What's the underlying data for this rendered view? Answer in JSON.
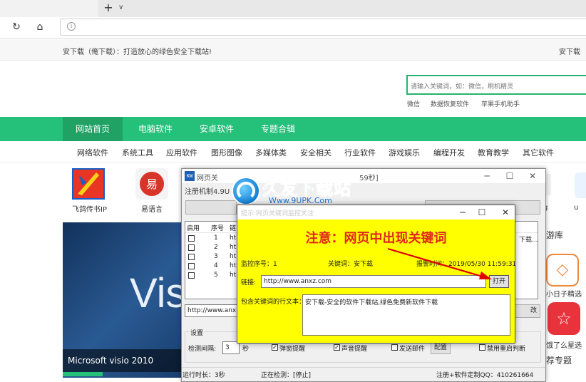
{
  "browser": {
    "new_tab": "+",
    "tab_menu": "∨",
    "reload_icon": "↻",
    "home_icon": "⌂",
    "address_info_icon": "i"
  },
  "site": {
    "slogan": "安下载（俺下载）：打造放心的绿色安全下载站!",
    "top_right_link": "安下载",
    "search_placeholder": "请输入关键词，如：微信，刷机精灵",
    "hot_words": [
      "微信",
      "数据恢复软件",
      "苹果手机助手"
    ],
    "main_nav": [
      "网站首页",
      "电脑软件",
      "安卓软件",
      "专题合辑"
    ],
    "sub_nav": [
      "网络软件",
      "系统工具",
      "应用软件",
      "图形图像",
      "多媒体类",
      "安全相关",
      "行业软件",
      "游戏娱乐",
      "编程开发",
      "教育教学",
      "其它软件"
    ],
    "apps": [
      {
        "label": "飞鸽传书IP"
      },
      {
        "label": "易语言"
      }
    ],
    "banner_word": "Visio",
    "banner_caption": "Microsoft visio 2010",
    "side_label_1": "游库",
    "side_label_2": "荐专题",
    "side_app_1": "小日子精选",
    "side_app_2": "饿了么星选",
    "side_top_1": "u",
    "side_top_2": "g",
    "accent_color": "#25c07a"
  },
  "watermark": {
    "text": "久友下载站",
    "url": "Www.9UPK.Com"
  },
  "main_window": {
    "logo": "KW",
    "title": "网页关",
    "timer": "59秒]",
    "reg_text": "注册机制4.9U",
    "list_headers": [
      "启用",
      "序号",
      "链"
    ],
    "rows": [
      {
        "seq": "1",
        "url": "ht"
      },
      {
        "seq": "2",
        "url": "ht"
      },
      {
        "seq": "3",
        "url": "ht"
      },
      {
        "seq": "4",
        "url": "ht"
      },
      {
        "seq": "5",
        "url": "ht"
      }
    ],
    "list_more": "下载...",
    "url_value": "http://www.anx",
    "modify_button": "改",
    "settings_title": "设置",
    "interval_label": "检测间隔:",
    "interval_value": "3",
    "interval_unit": "秒",
    "opt_popup": "弹窗提醒",
    "opt_sound": "声音提醒",
    "opt_mail": "发送邮件",
    "config_button": "配置",
    "opt_restart": "禁用重启判断",
    "status_runtime": "运行时长：3秒",
    "status_detect": "正在检测：[停止]",
    "status_contact": "注册+软件定制QQ：410261664"
  },
  "dialog": {
    "title": "提示:网页关键词监控关注",
    "heading": "注意：网页中出现关键词",
    "monitor_no": "监控序号：1",
    "keyword": "关键词：安下载",
    "alert_time": "报警时间：2019/05/30 11:59:31",
    "link_label": "链接:",
    "link_value": "http://www.anxz.com",
    "open_button": "打开",
    "text_label": "包含关键词的行文本：",
    "text_value": "安下载-安全的软件下载站,绿色免费新软件下载",
    "arrow_color": "#e00000"
  }
}
